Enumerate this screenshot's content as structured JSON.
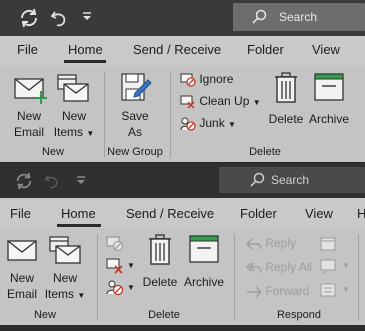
{
  "window1": {
    "search_label": "Search",
    "tabs": [
      "File",
      "Home",
      "Send / Receive",
      "Folder",
      "View"
    ],
    "new_email": [
      "New",
      "Email"
    ],
    "new_items": [
      "New",
      "Items"
    ],
    "save_as": [
      "Save",
      "As"
    ],
    "ignore": "Ignore",
    "clean_up": "Clean Up",
    "junk": "Junk",
    "delete": "Delete",
    "archive": "Archive",
    "group_new": "New",
    "group_new_group": "New Group",
    "group_delete": "Delete"
  },
  "window2": {
    "search_label": "Search",
    "tabs": [
      "File",
      "Home",
      "Send / Receive",
      "Folder",
      "View",
      "H"
    ],
    "new_email": [
      "New",
      "Email"
    ],
    "new_items": [
      "New",
      "Items"
    ],
    "delete": "Delete",
    "archive": "Archive",
    "reply": "Reply",
    "reply_all": "Reply All",
    "forward": "Forward",
    "group_new": "New",
    "group_delete": "Delete",
    "group_respond": "Respond"
  },
  "colors": {
    "titlebar": "#3a3a3a",
    "ribbon": "#c4c4c4",
    "accent_green": "#2e9e4a",
    "red_icon": "#c0392b",
    "blue_pen": "#3a73c4"
  }
}
